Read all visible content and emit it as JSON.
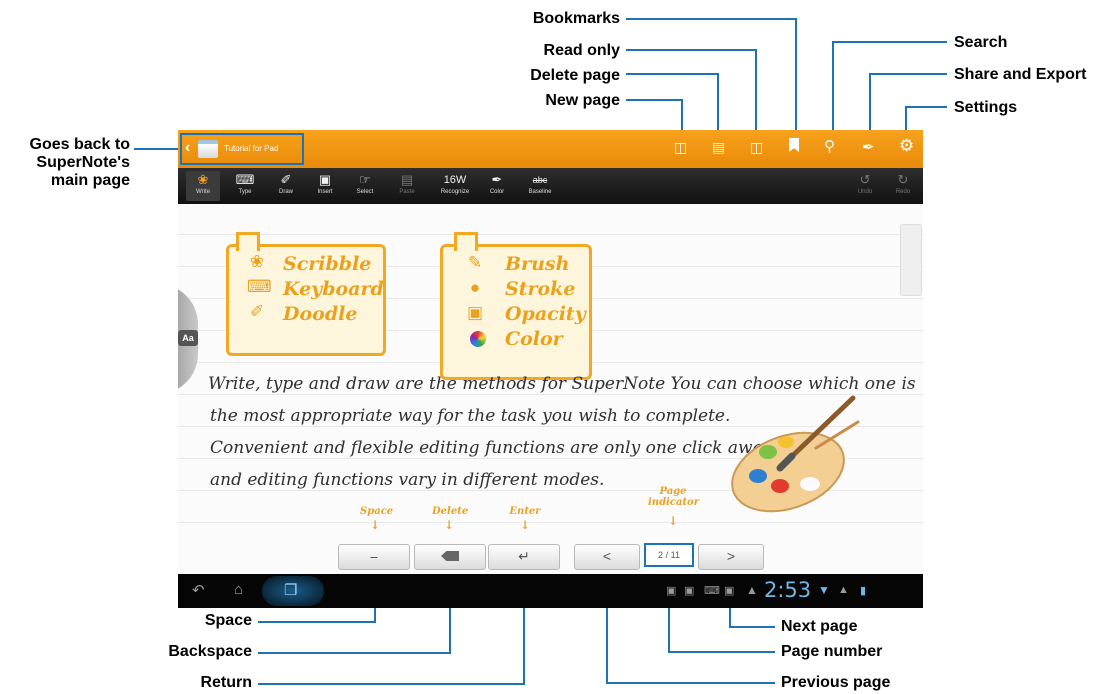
{
  "callouts": {
    "bookmarks": "Bookmarks",
    "read_only": "Read only",
    "delete_page": "Delete page",
    "new_page": "New page",
    "search": "Search",
    "share_export": "Share and Export",
    "settings": "Settings",
    "go_back": "Goes back to\nSuperNote's\nmain page",
    "space": "Space",
    "backspace": "Backspace",
    "return": "Return",
    "next_page": "Next page",
    "page_number": "Page number",
    "previous_page": "Previous page"
  },
  "app": {
    "notebook_title": "Tutorial for Pad"
  },
  "toolbar": {
    "write": "Write",
    "type": "Type",
    "draw": "Draw",
    "insert": "Insert",
    "select": "Select",
    "paste": "Paste",
    "recognize": "Recognize",
    "color": "Color",
    "baseline": "Baseline",
    "undo": "Undo",
    "redo": "Redo",
    "recognize_icon_text": "16W",
    "baseline_icon_text": "abc"
  },
  "side_tab": "Aa",
  "cards": {
    "left": [
      "Scribble",
      "Keyboard",
      "Doodle"
    ],
    "right": [
      "Brush",
      "Stroke",
      "Opacity",
      "Color"
    ]
  },
  "handwriting": [
    "Write, type and draw are the methods for SuperNote You can choose which one is",
    "the most appropriate way for the task you wish to complete.",
    "Convenient and flexible editing functions are only one click away",
    "and editing functions vary in different modes."
  ],
  "hints": {
    "space": "Space",
    "delete": "Delete",
    "enter": "Enter",
    "page_indicator": "Page\nindicator"
  },
  "pager": {
    "current": "2",
    "separator": "/",
    "total": "11"
  },
  "status": {
    "time": "2:53"
  },
  "colors": {
    "accent_orange": "#f39a15",
    "callout_line": "#1e73b8"
  }
}
